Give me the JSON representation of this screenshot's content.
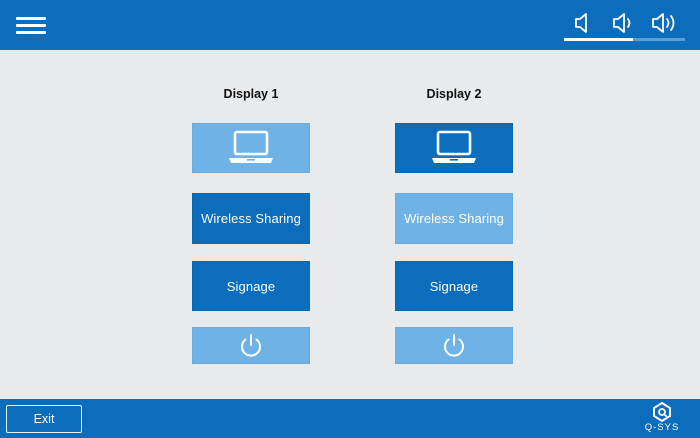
{
  "header": {
    "menu_icon": "hamburger-menu-icon",
    "volume_buttons": [
      {
        "icon": "volume-low-icon"
      },
      {
        "icon": "volume-mid-icon"
      },
      {
        "icon": "volume-high-icon"
      }
    ],
    "volume_level": 0.57
  },
  "displays": [
    {
      "title": "Display 1",
      "laptop_active": false,
      "wireless": {
        "label": "Wireless Sharing",
        "active": true
      },
      "signage": {
        "label": "Signage",
        "active": true
      },
      "power_active": false
    },
    {
      "title": "Display 2",
      "laptop_active": true,
      "wireless": {
        "label": "Wireless Sharing",
        "active": false
      },
      "signage": {
        "label": "Signage",
        "active": true
      },
      "power_active": false
    }
  ],
  "footer": {
    "exit_label": "Exit",
    "logo_text": "Q-SYS"
  },
  "colors": {
    "brand_blue": "#0b6dbb",
    "inactive_blue": "#6fb2e6",
    "background": "#e9eaec"
  }
}
